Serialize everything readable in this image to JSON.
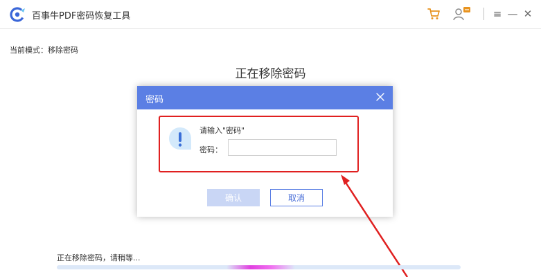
{
  "app": {
    "title": "百事牛PDF密码恢复工具",
    "brand_color": "#5b7fe4"
  },
  "toolbar": {
    "icons": [
      "cart-icon",
      "feedback-icon",
      "menu-icon",
      "minimize-icon",
      "close-icon"
    ],
    "menu_glyph": "≡",
    "minimize_glyph": "—",
    "close_glyph": "✕"
  },
  "mode": {
    "label": "当前模式：移除密码"
  },
  "page": {
    "heading": "正在移除密码"
  },
  "dialog": {
    "title": "密码",
    "prompt": "请输入\"密码\"",
    "field_label": "密码：",
    "password_value": "",
    "confirm_label": "确认",
    "cancel_label": "取消",
    "icon": "info-icon",
    "confirm_disabled": true
  },
  "progress": {
    "text": "正在移除密码，请稍等...",
    "indeterminate": true,
    "indicator_position": 0.42
  },
  "annotation": {
    "highlight_color": "#e02020"
  }
}
